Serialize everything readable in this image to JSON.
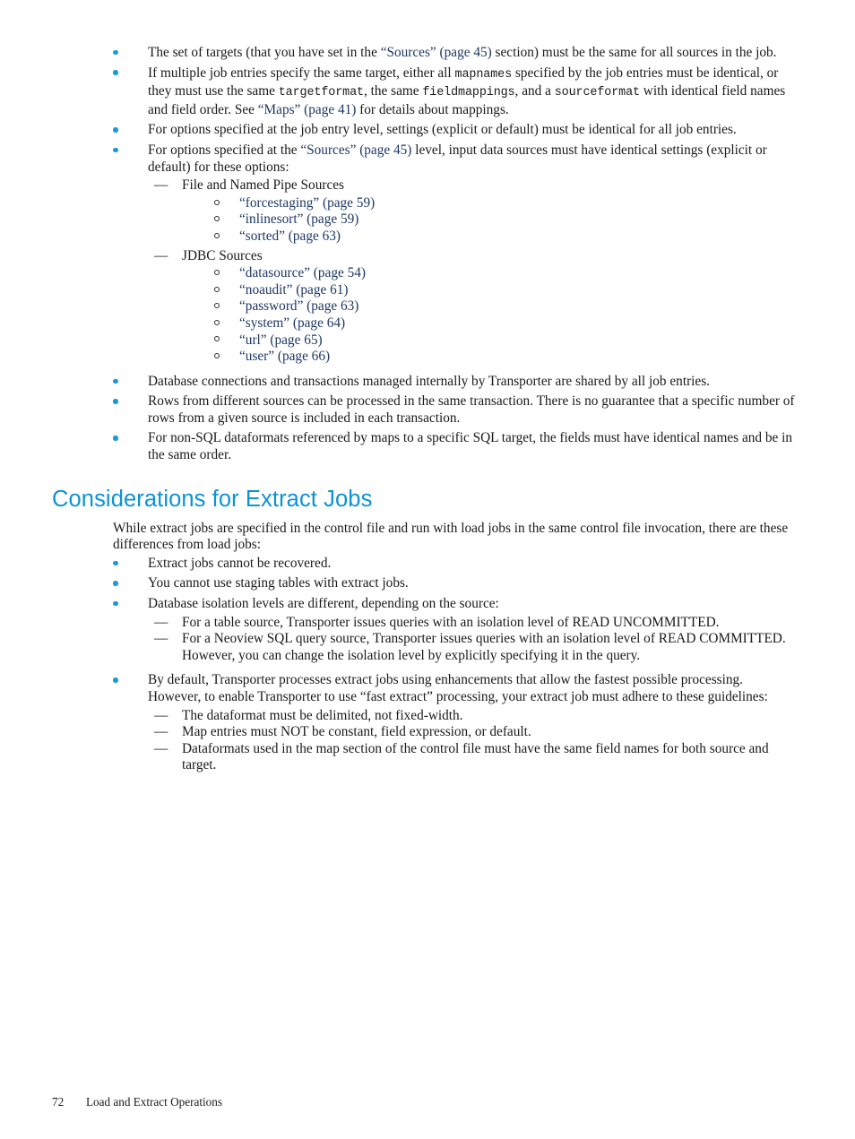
{
  "page": {
    "footer_page_number": "72",
    "footer_chapter": "Load and Extract Operations",
    "accent_color": "#0c93d4",
    "bullet_color": "#1b9ad8",
    "xref_color": "#1f3864",
    "body_color": "#1a1a1a",
    "background": "#ffffff"
  },
  "bullets": {
    "b1_a": "The set of targets (that you have set in the ",
    "b1_xref": "“Sources” (page 45)",
    "b1_b": " section) must be the same for all sources in the job.",
    "b2_a": "If multiple job entries specify the same target, either all ",
    "b2_code1": "mapnames",
    "b2_b": " specified by the job entries must be identical, or they must use the same ",
    "b2_code2": "targetformat",
    "b2_c": ", the same ",
    "b2_code3": "fieldmappings",
    "b2_d": ", and a ",
    "b2_code4": "sourceformat",
    "b2_e": " with identical field names and field order. See ",
    "b2_xref": "“Maps” (page 41)",
    "b2_f": " for details about mappings.",
    "b3": "For options specified at the job entry level, settings (explicit or default) must be identical for all job entries.",
    "b4_a": "For options specified at the ",
    "b4_xref": "“Sources” (page 45)",
    "b4_b": " level, input data sources must have identical settings (explicit or default) for these options:",
    "b5": "Database connections and transactions managed internally by Transporter are shared by all job entries.",
    "b6": "Rows from different sources can be processed in the same transaction. There is no guarantee that a specific number of rows from a given source is included in each transaction.",
    "b7": "For non-SQL dataformats referenced by maps to a specific SQL target, the fields must have identical names and be in the same order."
  },
  "sources_groups": [
    {
      "label": "File and Named Pipe Sources",
      "options": [
        "“forcestaging” (page 59)",
        "“inlinesort” (page 59)",
        "“sorted” (page 63)"
      ]
    },
    {
      "label": "JDBC Sources",
      "options": [
        "“datasource” (page 54)",
        "“noaudit” (page 61)",
        "“password” (page 63)",
        "“system” (page 64)",
        "“url” (page 65)",
        "“user” (page 66)"
      ]
    }
  ],
  "extract_section": {
    "heading": "Considerations for Extract Jobs",
    "intro": "While extract jobs are specified in the control file and run with load jobs in the same control file invocation, there are these differences from load jobs:",
    "e1": "Extract jobs cannot be recovered.",
    "e2": "You cannot use staging tables with extract jobs.",
    "e3": "Database isolation levels are different, depending on the source:",
    "e3_sub1": "For a table source, Transporter issues queries with an isolation level of READ UNCOMMITTED.",
    "e3_sub2": "For a Neoview SQL query source, Transporter issues queries with an isolation level of READ COMMITTED. However, you can change the isolation level by explicitly specifying it in the query.",
    "e4": "By default, Transporter processes extract jobs using enhancements that allow the fastest possible processing. However, to enable Transporter to use “fast extract” processing, your extract job must adhere to these guidelines:",
    "e4_sub1": "The dataformat must be delimited, not fixed-width.",
    "e4_sub2": "Map entries must NOT be constant, field expression, or default.",
    "e4_sub3": "Dataformats used in the map section of the control file must have the same field names for both source and target."
  },
  "markers": {
    "level2_dash": "—"
  }
}
